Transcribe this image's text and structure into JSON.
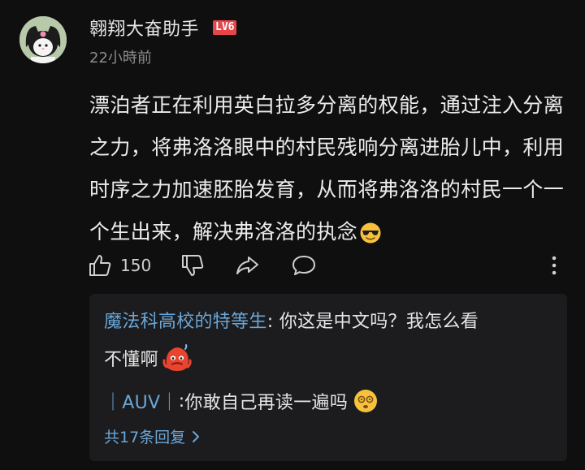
{
  "comment": {
    "username": "翱翔大奋助手",
    "level_badge": "LV6",
    "timestamp": "22小時前",
    "body": "漂泊者正在利用英白拉多分离的权能，通过注入分离之力，将弗洛洛眼中的村民残响分离进胎儿中，利用时序之力加速胚胎发育，从而将弗洛洛的村民一个一个生出来，解决弗洛洛的执念",
    "body_emoji": "sunglasses-emoji",
    "like_count": "150"
  },
  "actions": {
    "like_icon": "thumbs-up-icon",
    "dislike_icon": "thumbs-down-icon",
    "share_icon": "share-icon",
    "reply_icon": "reply-bubble-icon",
    "more_icon": "more-vertical-icon"
  },
  "replies": {
    "items": [
      {
        "author": "魔法科高校的特等生",
        "separator": ": ",
        "text_line1": "你这是中文吗？我怎么看",
        "text_line2": "不懂啊",
        "emoji": "red-sweating-blob-emoji"
      },
      {
        "author": "｜AUV｜",
        "separator": ": ",
        "text": "你敢自己再读一遍吗",
        "emoji": "dizzy-face-emoji"
      }
    ],
    "view_all_label": "共17条回复"
  },
  "colors": {
    "background": "#0f0f0f",
    "reply_box": "#1c1c1e",
    "link_blue": "#6aa6d6",
    "level_badge_red": "#e6454a"
  }
}
